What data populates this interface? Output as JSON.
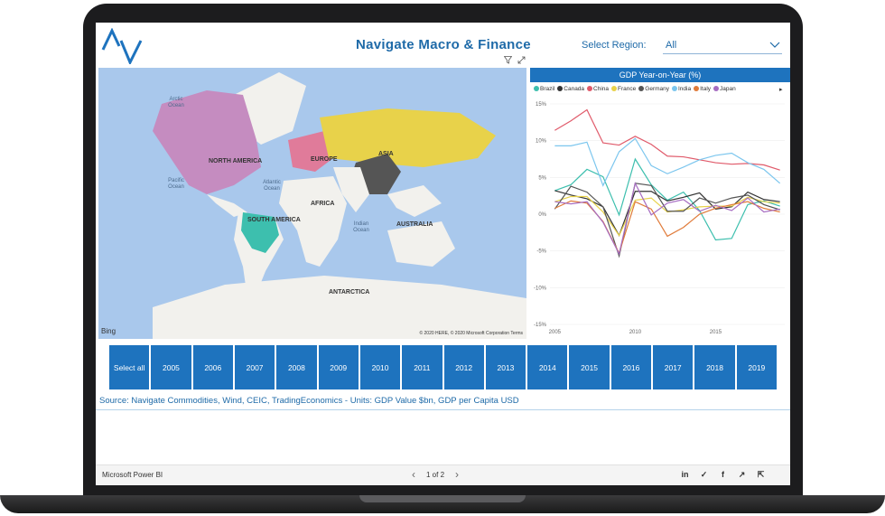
{
  "report": {
    "title": "Navigate Macro & Finance",
    "region_label": "Select Region:",
    "region_value": "All",
    "accent": "#1e73be"
  },
  "map": {
    "labels": [
      "NORTH AMERICA",
      "EUROPE",
      "ASIA",
      "AFRICA",
      "SOUTH AMERICA",
      "AUSTRALIA",
      "ANTARCTICA"
    ],
    "oceans": [
      "Arctic Ocean",
      "Pacific Ocean",
      "Atlantic Ocean",
      "Indian Ocean"
    ],
    "bing": "Bing",
    "copyright": "© 2020 HERE, © 2020 Microsoft Corporation  Terms"
  },
  "chart_data": {
    "type": "line",
    "title": "GDP Year-on-Year (%)",
    "ylim": [
      -15,
      15
    ],
    "yticks": [
      "15%",
      "10%",
      "5%",
      "0%",
      "-5%",
      "-10%",
      "-15%"
    ],
    "xticks": [
      "2005",
      "2010",
      "2015"
    ],
    "x": [
      2005,
      2006,
      2007,
      2008,
      2009,
      2010,
      2011,
      2012,
      2013,
      2014,
      2015,
      2016,
      2017,
      2018,
      2019
    ],
    "series": [
      {
        "name": "Brazil",
        "color": "#3dbfae",
        "values": [
          3.2,
          4.0,
          6.1,
          5.1,
          -0.1,
          7.5,
          4.0,
          1.9,
          3.0,
          0.5,
          -3.5,
          -3.3,
          1.3,
          1.8,
          1.1
        ]
      },
      {
        "name": "Canada",
        "color": "#333333",
        "values": [
          3.2,
          2.6,
          2.1,
          1.0,
          -2.9,
          3.1,
          3.1,
          1.8,
          2.3,
          2.9,
          0.7,
          1.0,
          3.0,
          2.0,
          1.7
        ]
      },
      {
        "name": "China",
        "color": "#e05a6a",
        "values": [
          11.4,
          12.7,
          14.2,
          9.7,
          9.4,
          10.6,
          9.5,
          7.9,
          7.8,
          7.4,
          7.0,
          6.8,
          6.9,
          6.7,
          6.0
        ]
      },
      {
        "name": "France",
        "color": "#e8d24a",
        "values": [
          1.7,
          2.4,
          2.4,
          0.3,
          -2.9,
          1.9,
          2.2,
          0.3,
          0.6,
          1.0,
          1.1,
          1.1,
          2.3,
          1.7,
          1.5
        ]
      },
      {
        "name": "Germany",
        "color": "#555555",
        "values": [
          0.7,
          3.8,
          3.0,
          1.0,
          -5.7,
          4.2,
          3.9,
          0.4,
          0.4,
          2.2,
          1.5,
          2.2,
          2.6,
          1.3,
          0.6
        ]
      },
      {
        "name": "India",
        "color": "#7cc6ee",
        "values": [
          9.3,
          9.3,
          9.8,
          3.9,
          8.5,
          10.3,
          6.6,
          5.5,
          6.4,
          7.4,
          8.0,
          8.3,
          7.0,
          6.1,
          4.2
        ]
      },
      {
        "name": "Italy",
        "color": "#e07b3a",
        "values": [
          0.8,
          1.8,
          1.5,
          -1.0,
          -5.3,
          1.7,
          0.7,
          -3.0,
          -1.8,
          0.0,
          0.8,
          1.3,
          1.7,
          0.8,
          0.3
        ]
      },
      {
        "name": "Japan",
        "color": "#a66cc1",
        "values": [
          1.7,
          1.4,
          1.7,
          -1.1,
          -5.4,
          4.2,
          -0.1,
          1.5,
          2.0,
          0.4,
          1.2,
          0.5,
          2.2,
          0.3,
          0.7
        ]
      }
    ]
  },
  "years": [
    "Select all",
    "2005",
    "2006",
    "2007",
    "2008",
    "2009",
    "2010",
    "2011",
    "2012",
    "2013",
    "2014",
    "2015",
    "2016",
    "2017",
    "2018",
    "2019"
  ],
  "source": "Source: Navigate Commodities, Wind, CEIC, TradingEconomics - Units: GDP Value $bn, GDP per Capita USD",
  "footer": {
    "brand": "Microsoft Power BI",
    "page": "1 of 2"
  }
}
